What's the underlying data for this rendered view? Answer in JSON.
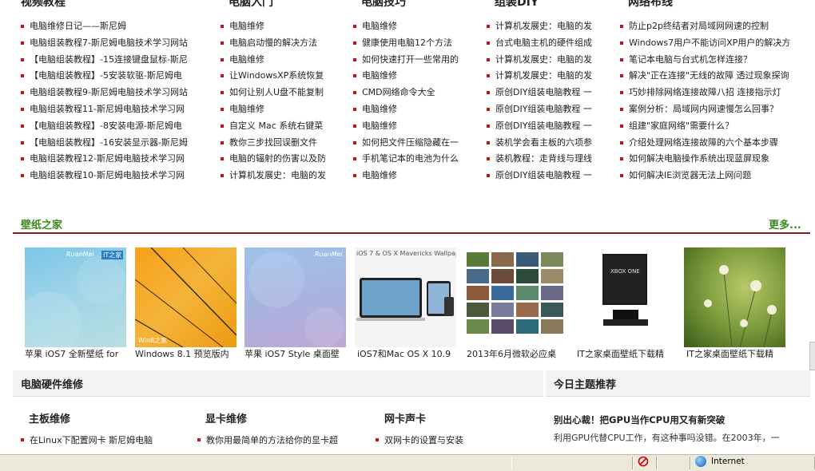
{
  "columns": [
    {
      "title": "视频教程",
      "items": [
        "电脑维修日记——斯尼姆",
        "电脑组装教程7-斯尼姆电脑技术学习网站",
        "【电脑组装教程】-15连接键盘鼠标-斯尼",
        "【电脑组装教程】-5安装软驱-斯尼姆电",
        "电脑组装教程9-斯尼姆电脑技术学习网站",
        "电脑组装教程11-斯尼姆电脑技术学习网",
        "【电脑组装教程】-8安装电源-斯尼姆电",
        "【电脑组装教程】-16安装显示器-斯尼姆",
        "电脑组装教程12-斯尼姆电脑技术学习网",
        "电脑组装教程10-斯尼姆电脑技术学习网"
      ]
    },
    {
      "title": "电脑入门",
      "items": [
        "电脑维修",
        "电脑启动慢的解决方法",
        "电脑维修",
        "让WindowsXP系统恢复",
        "如何让别人U盘不能复制",
        "电脑维修",
        "自定义 Mac 系统右键菜",
        "教你三步找回误删文件",
        "电脑的辐射的伤害以及防",
        "计算机发展史：电脑的发"
      ]
    },
    {
      "title": "电脑技巧",
      "items": [
        "电脑维修",
        "健康使用电脑12个方法",
        "如何快速打开一些常用的",
        "电脑维修",
        "CMD网络命令大全",
        "电脑维修",
        "电脑维修",
        "如何把文件压缩隐藏在一",
        "手机笔记本的电池为什么",
        "电脑维修"
      ]
    },
    {
      "title": "组装DIY",
      "items": [
        "计算机发展史：电脑的发",
        "台式电脑主机的硬件组成",
        "计算机发展史：电脑的发",
        "计算机发展史：电脑的发",
        "原创DIY组装电脑教程 一",
        "原创DIY组装电脑教程 一",
        "原创DIY组装电脑教程 一",
        "装机学会看主板的六项参",
        "装机教程：走背线与理线",
        "原创DIY组装电脑教程 一"
      ]
    },
    {
      "title": "网络布线",
      "items": [
        "防止p2p终结者对局域网网速的控制",
        "Windows7用户不能访问XP用户的解决方",
        "笔记本电脑与台式机怎样连接？",
        "解决\"正在连接\"无线的故障 透过现象探询",
        "巧妙排除网络连接故障八招 连接指示灯",
        "案例分析：局域网内网速慢怎么回事？",
        "组建\"家庭网络\"需要什么？",
        "介绍处理网络连接故障的六个基本步骤",
        "如何解决电脑操作系统出现蓝屏现象",
        "如何解决IE浏览器无法上网问题"
      ]
    }
  ],
  "wallpaper": {
    "title": "壁纸之家",
    "more": "更多...",
    "items": [
      {
        "caption": "苹果 iOS7 全新壁纸 for"
      },
      {
        "caption": "Windows 8.1 预览版内"
      },
      {
        "caption": "苹果 iOS7 Style 桌面壁"
      },
      {
        "caption": "iOS7和Mac OS X 10.9"
      },
      {
        "caption": "2013年6月微软必应桌"
      },
      {
        "caption": "IT之家桌面壁纸下载精"
      },
      {
        "caption": "IT之家桌面壁纸下载精"
      }
    ],
    "thumb_texts": {
      "ruanmei": "RuanMei",
      "itzhijia": "IT之家",
      "win8": "Win8之家",
      "mavericks": "iOS 7 & OS X Mavericks Wallpaper",
      "xbox": "XBOX ONE"
    }
  },
  "hardware": {
    "title": "电脑硬件维修",
    "subsections": [
      {
        "title": "主板维修",
        "item": "在Linux下配置网卡 斯尼姆电脑"
      },
      {
        "title": "显卡维修",
        "item": "教你用最简单的方法给你的显卡超"
      },
      {
        "title": "网卡声卡",
        "item": "双网卡的设置与安装"
      }
    ]
  },
  "today": {
    "title": "今日主题推荐",
    "headline": "别出心裁！把GPU当作CPU用又有新突破",
    "text": "利用GPU代替CPU工作，有这种事吗没错。在2003年，一"
  },
  "statusbar": {
    "zone": "Internet"
  },
  "colors": {
    "accent_red": "#c8101a",
    "accent_green": "#3a8a1f",
    "divider": "#8b1a1a"
  }
}
